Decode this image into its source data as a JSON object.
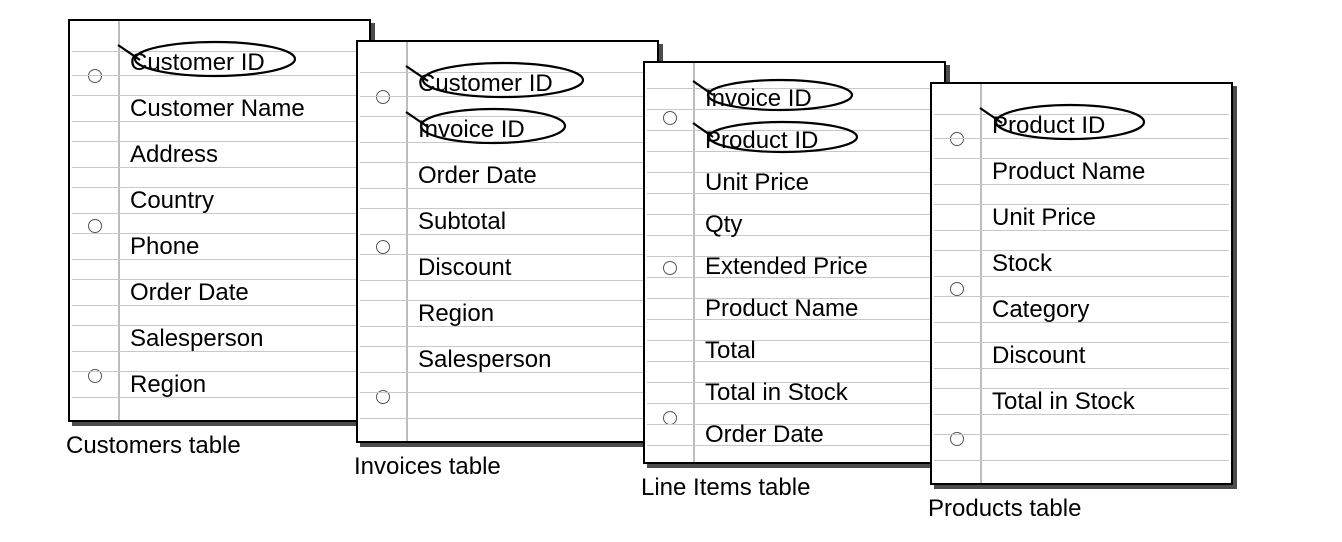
{
  "cards": [
    {
      "caption": "Customers table",
      "fields": [
        {
          "label": "Customer ID",
          "key": true
        },
        {
          "label": "Customer Name",
          "key": false
        },
        {
          "label": "Address",
          "key": false
        },
        {
          "label": "Country",
          "key": false
        },
        {
          "label": "Phone",
          "key": false
        },
        {
          "label": "Order Date",
          "key": false
        },
        {
          "label": "Salesperson",
          "key": false
        },
        {
          "label": "Region",
          "key": false
        }
      ]
    },
    {
      "caption": "Invoices table",
      "fields": [
        {
          "label": "Customer ID",
          "key": true
        },
        {
          "label": "Invoice ID",
          "key": true
        },
        {
          "label": "Order Date",
          "key": false
        },
        {
          "label": "Subtotal",
          "key": false
        },
        {
          "label": "Discount",
          "key": false
        },
        {
          "label": "Region",
          "key": false
        },
        {
          "label": "Salesperson",
          "key": false
        }
      ]
    },
    {
      "caption": "Line Items table",
      "fields": [
        {
          "label": "Invoice ID",
          "key": true
        },
        {
          "label": "Product ID",
          "key": true
        },
        {
          "label": "Unit Price",
          "key": false
        },
        {
          "label": "Qty",
          "key": false
        },
        {
          "label": "Extended Price",
          "key": false
        },
        {
          "label": "Product Name",
          "key": false
        },
        {
          "label": "Total",
          "key": false
        },
        {
          "label": "Total in Stock",
          "key": false
        },
        {
          "label": "Order Date",
          "key": false
        }
      ]
    },
    {
      "caption": "Products table",
      "fields": [
        {
          "label": "Product ID",
          "key": true
        },
        {
          "label": "Product Name",
          "key": false
        },
        {
          "label": "Unit Price",
          "key": false
        },
        {
          "label": "Stock",
          "key": false
        },
        {
          "label": "Category",
          "key": false
        },
        {
          "label": "Discount",
          "key": false
        },
        {
          "label": "Total in Stock",
          "key": false
        }
      ]
    }
  ]
}
